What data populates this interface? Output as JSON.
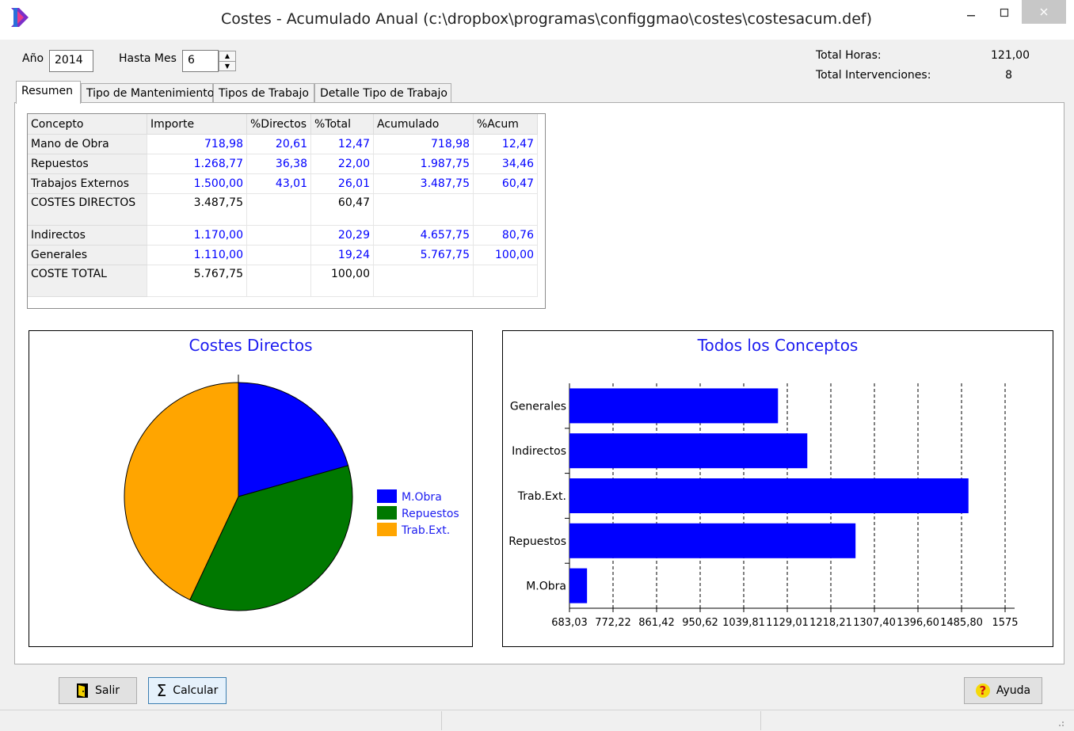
{
  "window": {
    "title": "Costes - Acumulado Anual (c:\\dropbox\\programas\\configgmao\\costes\\costesacum.def)",
    "minimize": "‒",
    "maximize": "☐",
    "close": "✕"
  },
  "header": {
    "year_label": "Año",
    "year_value": "2014",
    "month_label": "Hasta Mes",
    "month_value": "6",
    "total_hours_label": "Total Horas:",
    "total_hours_value": "121,00",
    "total_interventions_label": "Total Intervenciones:",
    "total_interventions_value": "8"
  },
  "tabs": [
    "Resumen",
    "Tipo de Mantenimiento",
    "Tipos de Trabajo",
    "Detalle Tipo de Trabajo"
  ],
  "grid": {
    "columns": [
      "Concepto",
      "Importe",
      "%Directos",
      "%Total",
      "Acumulado",
      "%Acum"
    ],
    "rows": [
      [
        "Mano de Obra",
        "718,98",
        "20,61",
        "12,47",
        "718,98",
        "12,47"
      ],
      [
        "Repuestos",
        "1.268,77",
        "36,38",
        "22,00",
        "1.987,75",
        "34,46"
      ],
      [
        "Trabajos Externos",
        "1.500,00",
        "43,01",
        "26,01",
        "3.487,75",
        "60,47"
      ],
      [
        "COSTES DIRECTOS",
        "3.487,75",
        "",
        "60,47",
        "",
        ""
      ],
      [
        "Indirectos",
        "1.170,00",
        "",
        "20,29",
        "4.657,75",
        "80,76"
      ],
      [
        "Generales",
        "1.110,00",
        "",
        "19,24",
        "5.767,75",
        "100,00"
      ],
      [
        "COSTE TOTAL",
        "5.767,75",
        "",
        "100,00",
        "",
        ""
      ]
    ]
  },
  "colors": {
    "blue": "#0000ff",
    "green": "#007800",
    "orange": "#ffa500",
    "title_blue": "#1c1cf0"
  },
  "chart_data": [
    {
      "type": "pie",
      "title": "Costes Directos",
      "categories": [
        "M.Obra",
        "Repuestos",
        "Trab.Ext."
      ],
      "values": [
        718.98,
        1268.77,
        1500.0
      ],
      "colors": [
        "#0000ff",
        "#007800",
        "#ffa500"
      ],
      "legend": "right"
    },
    {
      "type": "bar",
      "orientation": "horizontal",
      "title": "Todos los Conceptos",
      "categories": [
        "Generales",
        "Indirectos",
        "Trab.Ext.",
        "Repuestos",
        "M.Obra"
      ],
      "values": [
        1110.0,
        1170.0,
        1500.0,
        1268.77,
        718.98
      ],
      "xlim": [
        683.03,
        1575.0
      ],
      "xticks": [
        "683,03",
        "772,22",
        "861,42",
        "950,62",
        "1039,81",
        "1129,01",
        "1218,21",
        "1307,40",
        "1396,60",
        "1485,80",
        "1575"
      ],
      "grid": "vertical dashed",
      "color": "#0000ff"
    }
  ],
  "buttons": {
    "exit": "Salir",
    "calculate": "Calcular",
    "calculate_symbol": "Σ",
    "help": "Ayuda",
    "help_symbol": "?"
  }
}
